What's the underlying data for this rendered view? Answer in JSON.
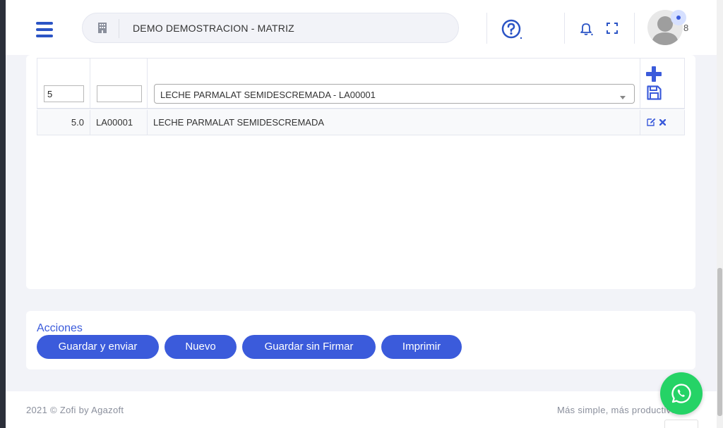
{
  "header": {
    "company_name": "DEMO DEMOSTRACION - MATRIZ",
    "notification_count": "8",
    "icons": [
      "menu-icon",
      "building-icon",
      "help-icon",
      "bell-icon",
      "fullscreen-icon",
      "avatar"
    ]
  },
  "items_table": {
    "input_row": {
      "quantity_value": "5",
      "code_value": "",
      "product_selected": "LECHE PARMALAT SEMIDESCREMADA - LA00001"
    },
    "rows": [
      {
        "quantity": "5.0",
        "code": "LA00001",
        "description": "LECHE PARMALAT SEMIDESCREMADA"
      }
    ]
  },
  "actions": {
    "title": "Acciones",
    "buttons": [
      "Guardar y enviar",
      "Nuevo",
      "Guardar sin Firmar",
      "Imprimir"
    ]
  },
  "footer": {
    "copyright": "2021 © Zofi by Agazoft",
    "tagline": "Más simple, más productivo"
  },
  "colors": {
    "accent": "#3b5bdb",
    "whatsapp": "#25d366",
    "background": "#f2f3f8"
  }
}
